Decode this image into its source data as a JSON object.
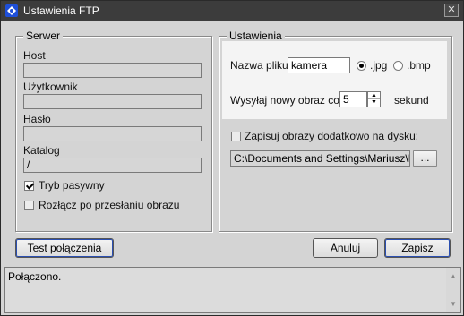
{
  "window": {
    "title": "Ustawienia FTP",
    "close_glyph": "✕"
  },
  "server": {
    "legend": "Serwer",
    "host_label": "Host",
    "host_value": "",
    "user_label": "Użytkownik",
    "user_value": "",
    "password_label": "Hasło",
    "password_value": "",
    "catalog_label": "Katalog",
    "catalog_value": "/",
    "passive_label": "Tryb pasywny",
    "passive_checked": true,
    "disconnect_label": "Rozłącz po przesłaniu obrazu",
    "disconnect_checked": false
  },
  "settings": {
    "legend": "Ustawienia",
    "filename_label": "Nazwa pliku",
    "filename_value": "kamera",
    "format_options": [
      ".jpg",
      ".bmp"
    ],
    "format_selected": ".jpg",
    "interval_label": "Wysyłaj nowy obraz co",
    "interval_value": "5",
    "interval_unit": "sekund",
    "save_disk_label": "Zapisuj obrazy dodatkowo na dysku:",
    "save_disk_checked": false,
    "path_value": "C:\\Documents and Settings\\Mariusz\\Moj",
    "browse_label": "..."
  },
  "buttons": {
    "test": "Test połączenia",
    "cancel": "Anuluj",
    "save": "Zapisz"
  },
  "status": {
    "text": "Połączono."
  },
  "icons": {
    "app": "ftp-app-icon",
    "scroll_up": "scroll-up-icon",
    "scroll_down": "scroll-down-icon"
  }
}
